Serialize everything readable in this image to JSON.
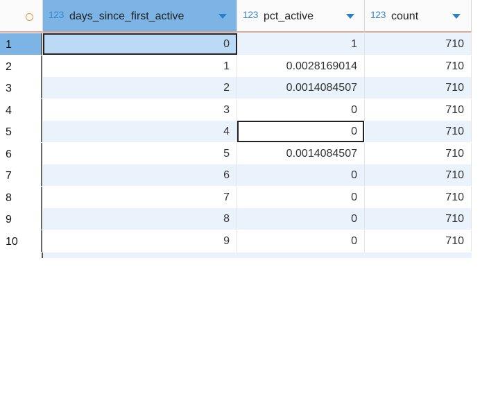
{
  "columns": [
    {
      "type_icon": "123",
      "name": "days_since_first_active"
    },
    {
      "type_icon": "123",
      "name": "pct_active"
    },
    {
      "type_icon": "123",
      "name": "count"
    }
  ],
  "rows": [
    {
      "num": "1",
      "cells": [
        "0",
        "1",
        "710"
      ]
    },
    {
      "num": "2",
      "cells": [
        "1",
        "0.0028169014",
        "710"
      ]
    },
    {
      "num": "3",
      "cells": [
        "2",
        "0.0014084507",
        "710"
      ]
    },
    {
      "num": "4",
      "cells": [
        "3",
        "0",
        "710"
      ]
    },
    {
      "num": "5",
      "cells": [
        "4",
        "0",
        "710"
      ]
    },
    {
      "num": "6",
      "cells": [
        "5",
        "0.0014084507",
        "710"
      ]
    },
    {
      "num": "7",
      "cells": [
        "6",
        "0",
        "710"
      ]
    },
    {
      "num": "8",
      "cells": [
        "7",
        "0",
        "710"
      ]
    },
    {
      "num": "9",
      "cells": [
        "8",
        "0",
        "710"
      ]
    },
    {
      "num": "10",
      "cells": [
        "9",
        "0",
        "710"
      ]
    }
  ],
  "colors": {
    "selected_header": "#7cb4e6",
    "alt_row": "#eaf3fc",
    "type_icon": "#3a88c8",
    "accent": "#e49a3c"
  }
}
